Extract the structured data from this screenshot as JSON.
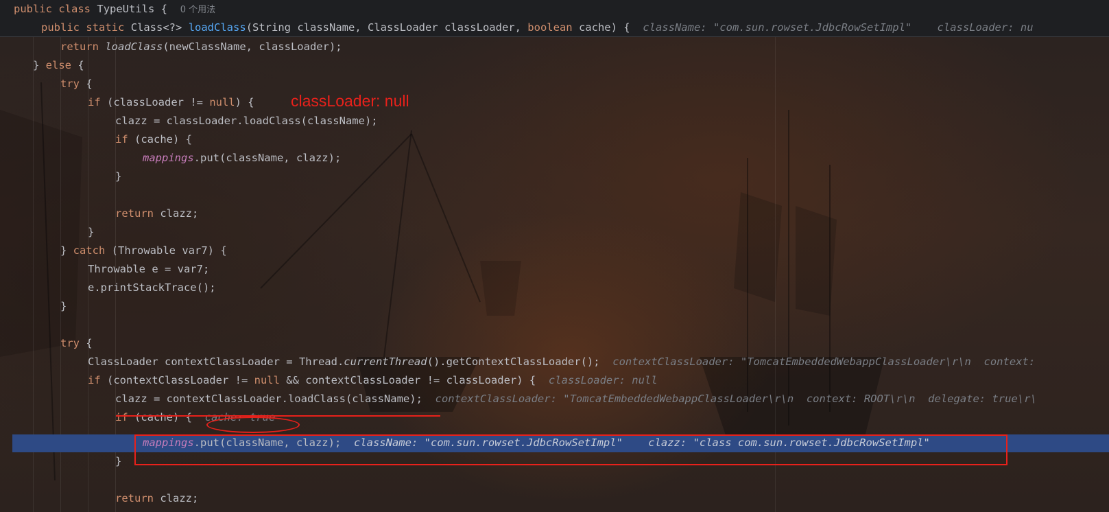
{
  "editor": {
    "sticky": {
      "line1": {
        "kw1": "public",
        "kw2": "class",
        "name": "TypeUtils {",
        "usages": "0 个用法"
      },
      "line2": {
        "kw1": "public",
        "kw2": "static",
        "type": "Class<?>",
        "method": "loadClass",
        "params_a": "(String className, ClassLoader classLoader, ",
        "kw_boolean": "boolean",
        "params_b": " cache) {",
        "hint": "className: \"com.sun.rowset.JdbcRowSetImpl\"    classLoader: nu"
      }
    },
    "lines": {
      "l1": {
        "kw": "return",
        "call": "loadClass",
        "rest": "(newClassName, classLoader);"
      },
      "l2": {
        "a": "} ",
        "kw": "else",
        "b": " {"
      },
      "l3": {
        "kw": "try",
        "rest": " {"
      },
      "l4": {
        "kw": "if",
        "a": " (classLoader != ",
        "null_kw": "null",
        "b": ") {"
      },
      "l5": {
        "code": "clazz = classLoader.loadClass(className);"
      },
      "l6": {
        "kw": "if",
        "rest": " (cache) {"
      },
      "l7": {
        "field": "mappings",
        "rest": ".put(className, clazz);"
      },
      "l8": {
        "code": "}"
      },
      "l9": {
        "kw": "return",
        "rest": " clazz;"
      },
      "l10": {
        "code": "}"
      },
      "l11": {
        "a": "} ",
        "kw": "catch",
        "b": " (Throwable var7) {"
      },
      "l12": {
        "code": "Throwable e = var7;"
      },
      "l13": {
        "code": "e.printStackTrace();"
      },
      "l14": {
        "code": "}"
      },
      "l15": {
        "kw": "try",
        "rest": " {"
      },
      "l16": {
        "a": "ClassLoader contextClassLoader = Thread.",
        "static_call": "currentThread",
        "b": "().getContextClassLoader();",
        "hint": "contextClassLoader: \"TomcatEmbeddedWebappClassLoader\\r\\n  context: "
      },
      "l17": {
        "kw": "if",
        "a": " (contextClassLoader != ",
        "null_kw": "null",
        "b": " && contextClassLoader != classLoader) {",
        "hint": "classLoader: null"
      },
      "l18": {
        "code": "clazz = contextClassLoader.loadClass(className);",
        "hint": "contextClassLoader: \"TomcatEmbeddedWebappClassLoader\\r\\n  context: ROOT\\r\\n  delegate: true\\r\\"
      },
      "l19": {
        "kw": "if",
        "rest": " (cache) {",
        "hint": "cache: true"
      },
      "l20": {
        "field": "mappings",
        "rest": ".put(className, clazz);",
        "hint": "className: \"com.sun.rowset.JdbcRowSetImpl\"    clazz: \"class com.sun.rowset.JdbcRowSetImpl\""
      },
      "l21": {
        "code": "}"
      },
      "l22": {
        "kw": "return",
        "rest": " clazz;"
      }
    }
  },
  "annotation": {
    "text": "classLoader: null",
    "color": "#e8211b"
  },
  "colors": {
    "keyword": "#cf8e6d",
    "method": "#56a8f5",
    "field": "#c77dbb",
    "hint": "#7a7e85",
    "highlight": "#2e4a85"
  }
}
